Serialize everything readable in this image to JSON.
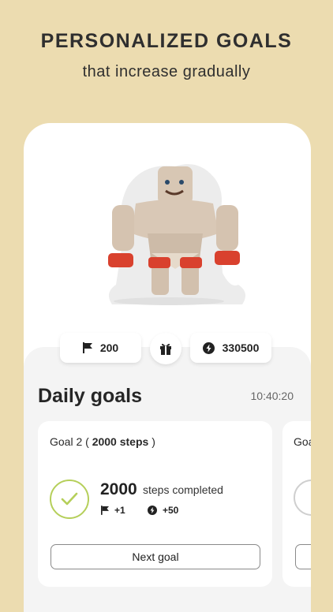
{
  "promo": {
    "headline": "PERSONALIZED GOALS",
    "subheadline": "that increase gradually"
  },
  "stats": {
    "flags": "200",
    "flags_icon": "flag-icon",
    "gift_icon": "gift-icon",
    "energy": "330500",
    "energy_icon": "lightning-icon"
  },
  "daily": {
    "title": "Daily goals",
    "clock": "10:40:20"
  },
  "goal_card": {
    "prefix": "Goal 2 ( ",
    "steps_label": "2000 steps",
    "suffix": " )",
    "steps_value": "2000",
    "steps_text": "steps completed",
    "reward_flags": "+1",
    "reward_energy": "+50",
    "next_label": "Next goal"
  },
  "peek_card": {
    "title": "Goa"
  },
  "colors": {
    "background": "#ecdcb0",
    "accent_green": "#b5cf5a"
  }
}
